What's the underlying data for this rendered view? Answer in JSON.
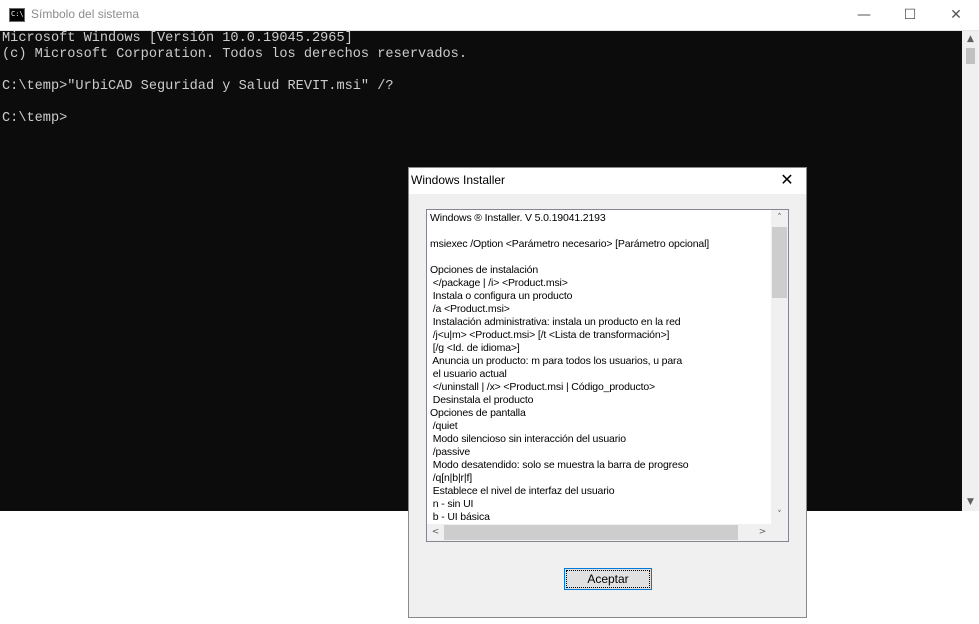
{
  "console": {
    "title": "Símbolo del sistema",
    "app_icon": "cmd-icon",
    "app_icon_text": "C:\\",
    "caption": {
      "minimize": "—",
      "maximize": "☐",
      "close": "✕"
    },
    "lines": [
      "Microsoft Windows [Versión 10.0.19045.2965]",
      "(c) Microsoft Corporation. Todos los derechos reservados.",
      "",
      "C:\\temp>\"UrbiCAD Seguridad y Salud REVIT.msi\" /?",
      "",
      "C:\\temp>"
    ],
    "scroll": {
      "up": "▲",
      "down": "▼"
    }
  },
  "installer": {
    "title": "Windows Installer",
    "close": "✕",
    "help_lines": [
      "Windows ® Installer. V 5.0.19041.2193",
      "",
      "msiexec /Option <Parámetro necesario> [Parámetro opcional]",
      "",
      "Opciones de instalación",
      " </package | /i> <Product.msi>",
      " Instala o configura un producto",
      " /a <Product.msi>",
      " Instalación administrativa: instala un producto en la red",
      " /j<u|m> <Product.msi> [/t <Lista de transformación>]",
      " [/g <Id. de idioma>]",
      " Anuncia un producto: m para todos los usuarios, u para",
      " el usuario actual",
      " </uninstall | /x> <Product.msi | Código_producto>",
      " Desinstala el producto",
      "Opciones de pantalla",
      " /quiet",
      " Modo silencioso sin interacción del usuario",
      " /passive",
      " Modo desatendido: solo se muestra la barra de progreso",
      " /q[n|b|r|f]",
      " Establece el nivel de interfaz del usuario",
      " n - sin UI",
      " b - UI básica"
    ],
    "scroll": {
      "up": "˄",
      "down": "˅",
      "left": "<",
      "right": ">"
    },
    "accept_label": "Aceptar"
  }
}
